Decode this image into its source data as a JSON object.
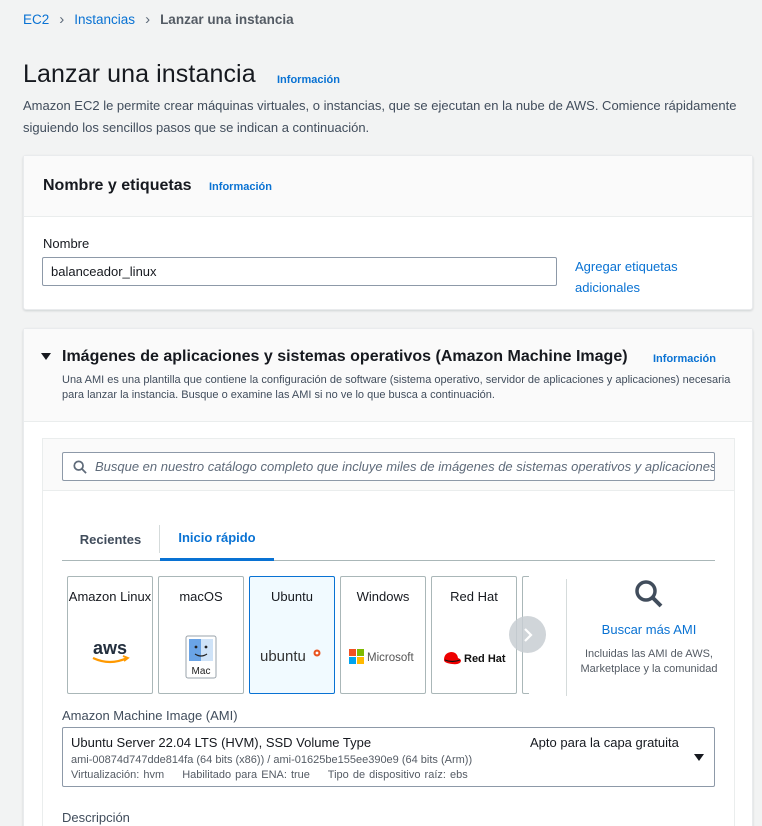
{
  "breadcrumb": {
    "items": [
      "EC2",
      "Instancias"
    ],
    "current": "Lanzar una instancia"
  },
  "page": {
    "title": "Lanzar una instancia",
    "info": "Información",
    "description": "Amazon EC2 le permite crear máquinas virtuales, o instancias, que se ejecutan en la nube de AWS. Comience rápidamente siguiendo los sencillos pasos que se indican a continuación."
  },
  "name_section": {
    "title": "Nombre y etiquetas",
    "info": "Información",
    "name_label": "Nombre",
    "name_value": "balanceador_linux",
    "add_tags": "Agregar etiquetas adicionales"
  },
  "ami_section": {
    "title": "Imágenes de aplicaciones y sistemas operativos (Amazon Machine Image)",
    "info": "Información",
    "description": "Una AMI es una plantilla que contiene la configuración de software (sistema operativo, servidor de aplicaciones y aplicaciones) necesaria para lanzar la instancia. Busque o examine las AMI si no ve lo que busca a continuación.",
    "search_placeholder": "Busque en nuestro catálogo completo que incluye miles de imágenes de sistemas operativos y aplicaciones",
    "tabs": [
      {
        "label": "Recientes",
        "active": false
      },
      {
        "label": "Inicio rápido",
        "active": true
      }
    ],
    "tiles": [
      {
        "name": "Amazon Linux",
        "logo_text": "aws",
        "icon": "aws-logo",
        "selected": false
      },
      {
        "name": "macOS",
        "logo_text": "Mac",
        "icon": "mac-finder-logo",
        "selected": false
      },
      {
        "name": "Ubuntu",
        "logo_text": "ubuntu",
        "icon": "ubuntu-logo",
        "selected": true
      },
      {
        "name": "Windows",
        "logo_text": "Microsoft",
        "icon": "microsoft-logo",
        "selected": false
      },
      {
        "name": "Red Hat",
        "logo_text": "Red Hat",
        "icon": "redhat-logo",
        "selected": false
      },
      {
        "name": "S",
        "logo_text": "",
        "icon": "",
        "selected": false
      }
    ],
    "browse": {
      "title": "Buscar más AMI",
      "description": "Incluidas las AMI de AWS, Marketplace y la comunidad"
    },
    "ami_label": "Amazon Machine Image (AMI)",
    "selected_ami": {
      "name": "Ubuntu Server 22.04 LTS (HVM), SSD Volume Type",
      "badge": "Apto para la capa gratuita",
      "ids": "ami-00874d747dde814fa (64 bits (x86)) / ami-01625be155ee390e9 (64 bits (Arm))",
      "virtualization": "Virtualización: hvm",
      "ena": "Habilitado para ENA: true",
      "root_device": "Tipo de dispositivo raíz: ebs"
    },
    "description_label": "Descripción"
  },
  "colors": {
    "link": "#0972d3",
    "selected_tile_bg": "#f1faff"
  }
}
